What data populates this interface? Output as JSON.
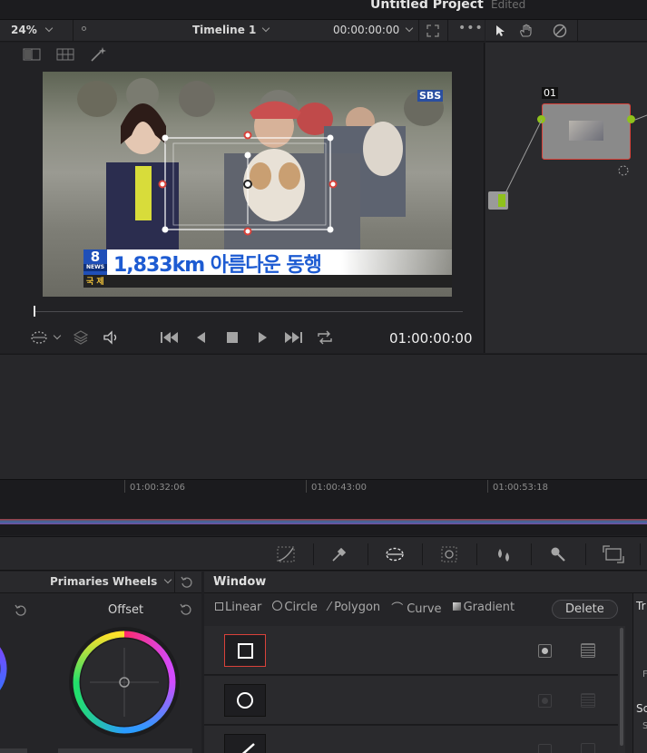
{
  "project": {
    "title": "Untitled Project",
    "status": "Edited"
  },
  "viewer": {
    "zoom": "24%",
    "timeline_name": "Timeline 1",
    "header_timecode": "00:00:00:00",
    "playback_timecode": "01:00:00:00",
    "caption_headline": "1,833km 아름다운 동행",
    "caption_tag": "국 제",
    "caption_logo": "8",
    "caption_logo_sub": "NEWS",
    "broadcaster_mark": "SBS"
  },
  "nodes": {
    "node_label": "01"
  },
  "timeline": {
    "ruler_labels": [
      "01:00:32:06",
      "01:00:43:00",
      "01:00:53:18"
    ]
  },
  "primaries": {
    "mode": "Primaries Wheels",
    "wheel_label": "Offset"
  },
  "window": {
    "title": "Window",
    "tools": [
      "Linear",
      "Circle",
      "Polygon",
      "Curve",
      "Gradient"
    ],
    "delete_label": "Delete",
    "side_labels": [
      "Tr",
      "F",
      "Sc",
      "S"
    ]
  },
  "colors": {
    "accent_red": "#d9423a",
    "node_green": "#8fc11c",
    "bg": "#1f1f22"
  }
}
